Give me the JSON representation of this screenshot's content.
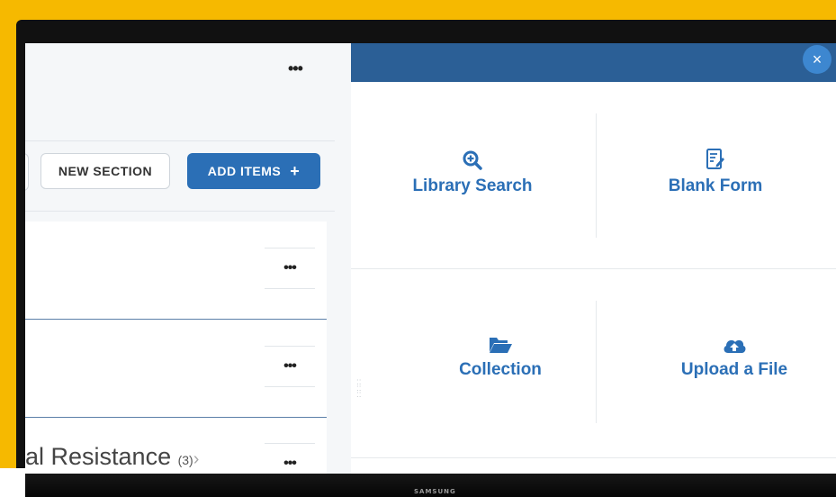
{
  "left_panel": {
    "more_label": "•••",
    "new_section_label": "NEW SECTION",
    "add_items_label": "ADD ITEMS",
    "add_items_icon": "+",
    "rows": [
      {
        "more": "•••"
      },
      {
        "more": "•••"
      },
      {
        "more": "•••",
        "title_fragment": "al Resistance",
        "count": "(3)",
        "chevron": "›"
      }
    ]
  },
  "right_panel": {
    "close_icon": "×",
    "tiles": [
      {
        "label": "Library Search",
        "icon": "search-plus-icon"
      },
      {
        "label": "Blank Form",
        "icon": "edit-document-icon"
      },
      {
        "label": "Collection",
        "icon": "folder-open-icon"
      },
      {
        "label": "Upload a File",
        "icon": "cloud-upload-icon"
      }
    ]
  },
  "monitor": {
    "brand": "SAMSUNG"
  },
  "colors": {
    "accent": "#2b6fb6",
    "header": "#2b5f96",
    "background": "#f6b900"
  }
}
